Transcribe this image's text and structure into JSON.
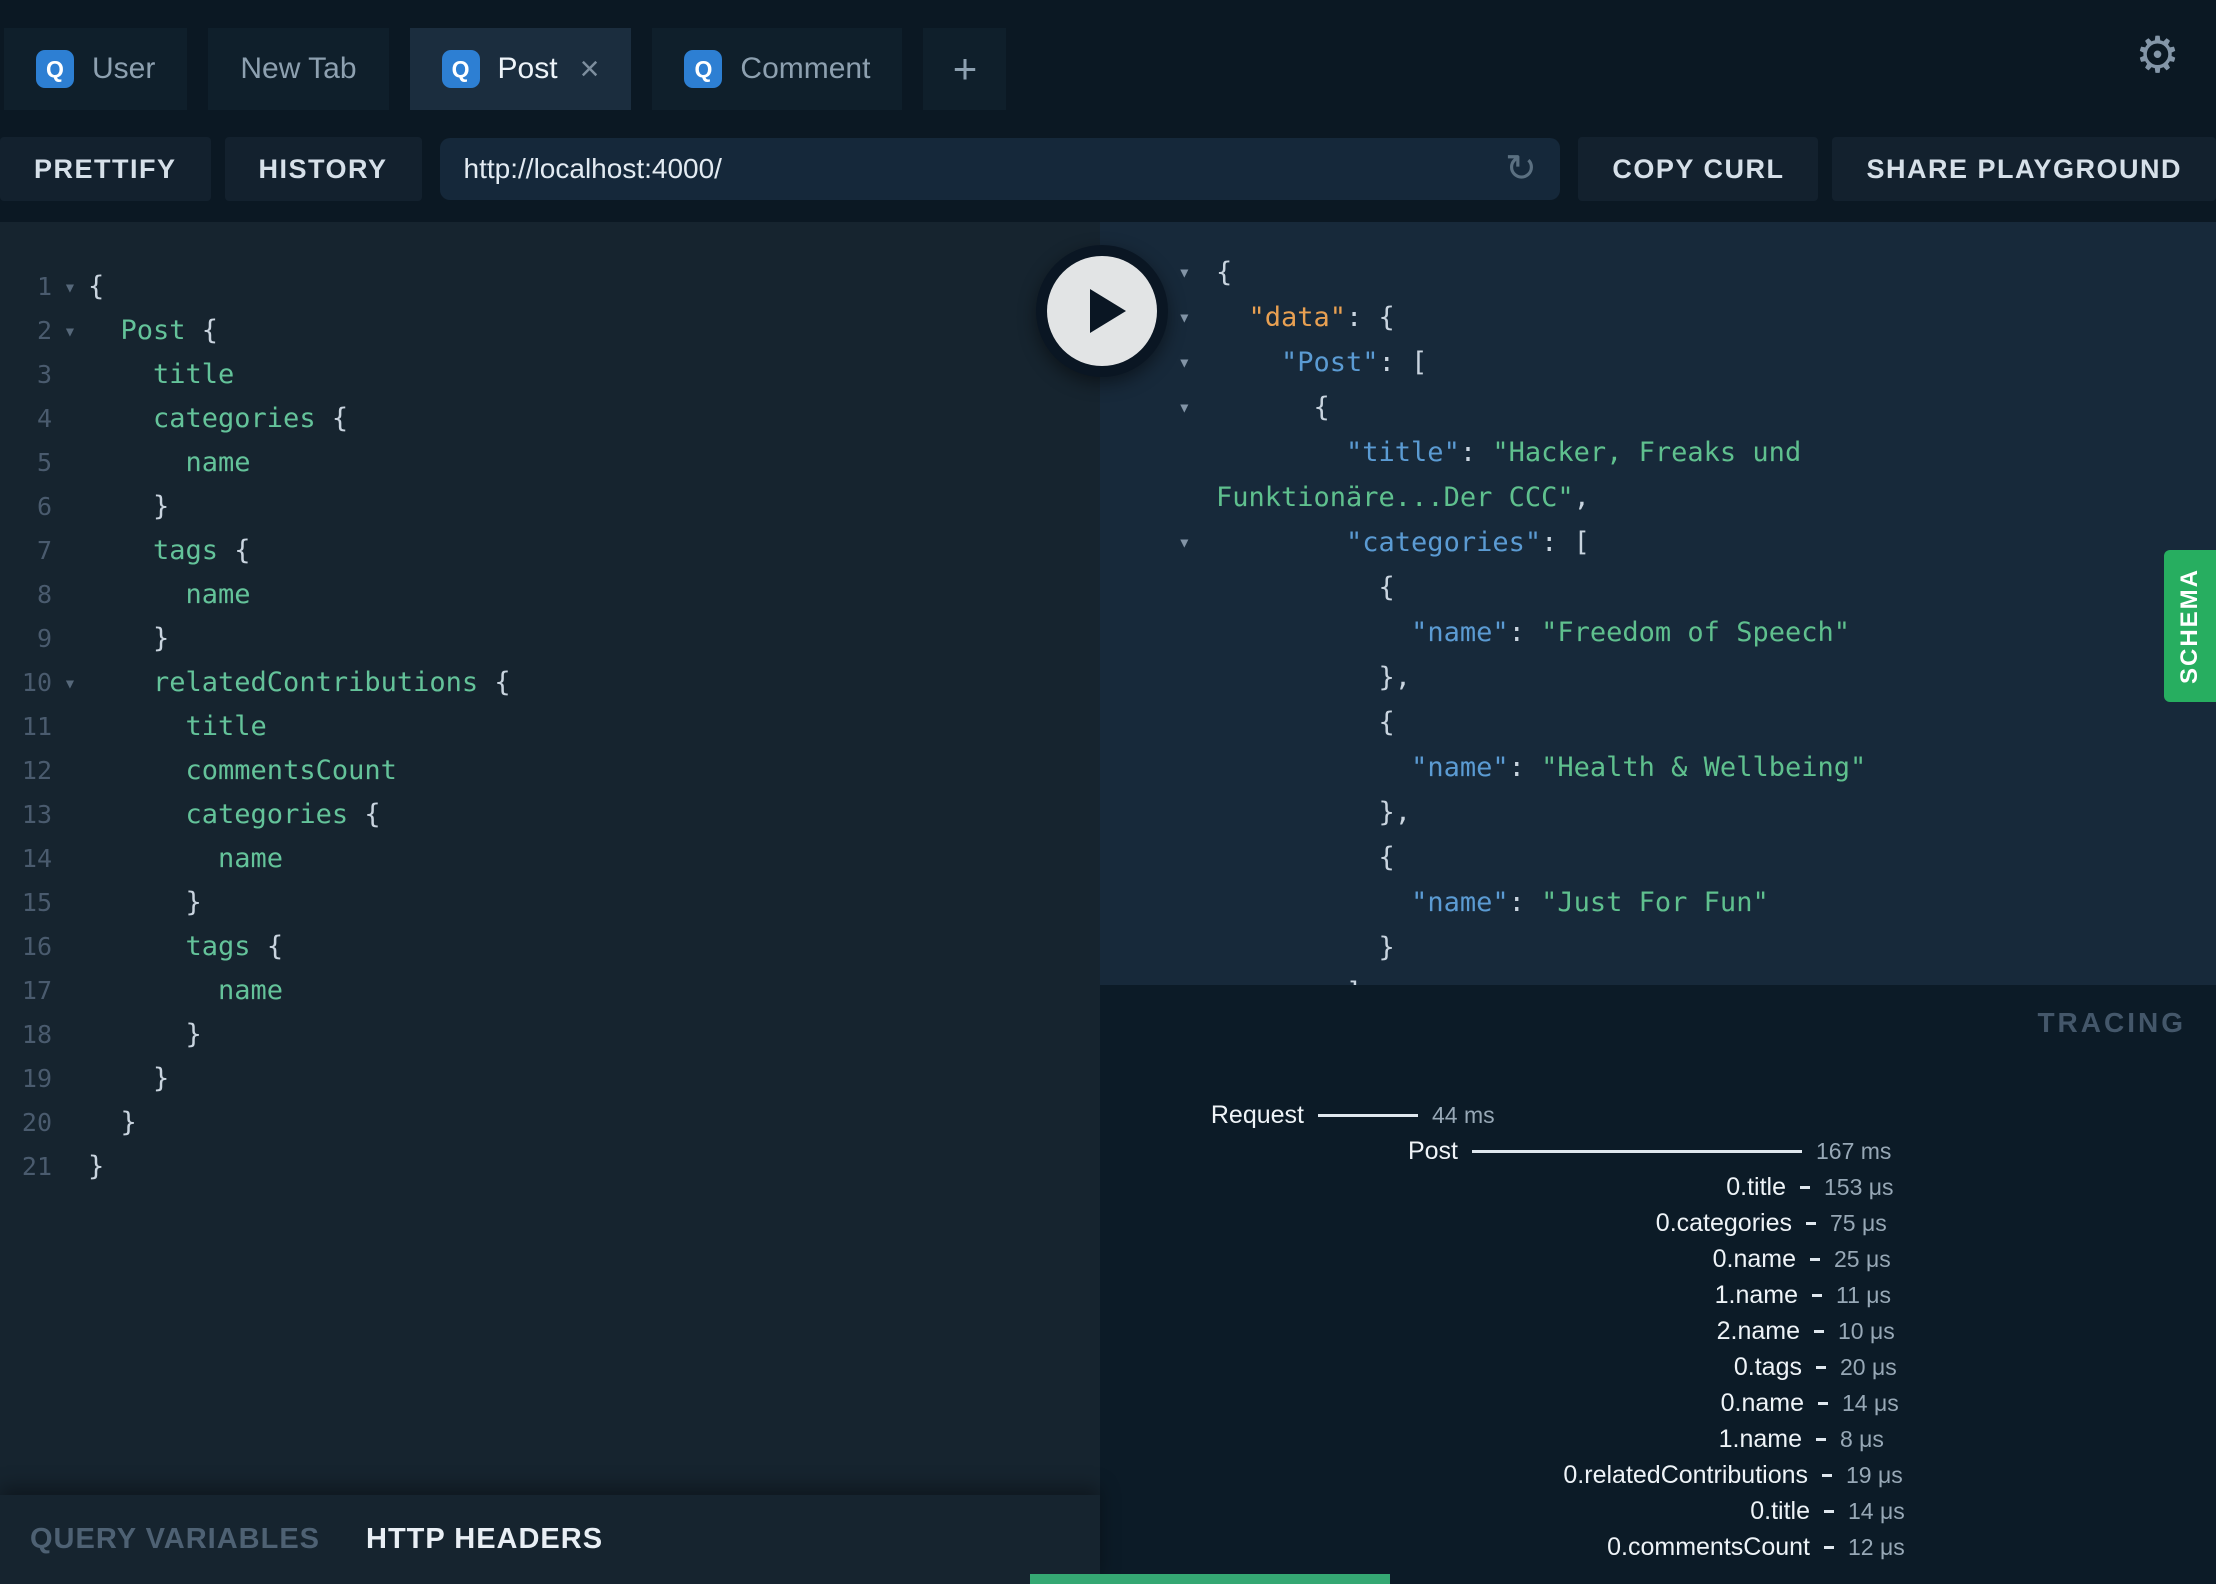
{
  "tabs": {
    "close_glyph": "×",
    "add_label": "+",
    "items": [
      {
        "label": "User",
        "badge": "Q",
        "active": false,
        "closable": false
      },
      {
        "label": "New Tab",
        "badge": null,
        "active": false,
        "closable": false
      },
      {
        "label": "Post",
        "badge": "Q",
        "active": true,
        "closable": true
      },
      {
        "label": "Comment",
        "badge": "Q",
        "active": false,
        "closable": false
      }
    ]
  },
  "icons": {
    "gear": "⚙",
    "reload": "↺",
    "fold": "▾"
  },
  "toolbar": {
    "prettify": "PRETTIFY",
    "history": "HISTORY",
    "url": "http://localhost:4000/",
    "copy_curl": "COPY CURL",
    "share": "SHARE PLAYGROUND"
  },
  "editor": {
    "lines": [
      {
        "n": 1,
        "i": 0,
        "fold": true,
        "tok": [
          [
            "p",
            "{"
          ]
        ]
      },
      {
        "n": 2,
        "i": 2,
        "fold": true,
        "tok": [
          [
            "f",
            "Post"
          ],
          [
            "p",
            " {"
          ]
        ]
      },
      {
        "n": 3,
        "i": 4,
        "fold": false,
        "tok": [
          [
            "f",
            "title"
          ]
        ]
      },
      {
        "n": 4,
        "i": 4,
        "fold": false,
        "tok": [
          [
            "f",
            "categories"
          ],
          [
            "p",
            " {"
          ]
        ]
      },
      {
        "n": 5,
        "i": 6,
        "fold": false,
        "tok": [
          [
            "f",
            "name"
          ]
        ]
      },
      {
        "n": 6,
        "i": 4,
        "fold": false,
        "tok": [
          [
            "p",
            "}"
          ]
        ]
      },
      {
        "n": 7,
        "i": 4,
        "fold": false,
        "tok": [
          [
            "f",
            "tags"
          ],
          [
            "p",
            " {"
          ]
        ]
      },
      {
        "n": 8,
        "i": 6,
        "fold": false,
        "tok": [
          [
            "f",
            "name"
          ]
        ]
      },
      {
        "n": 9,
        "i": 4,
        "fold": false,
        "tok": [
          [
            "p",
            "}"
          ]
        ]
      },
      {
        "n": 10,
        "i": 4,
        "fold": true,
        "tok": [
          [
            "f",
            "relatedContributions"
          ],
          [
            "p",
            " {"
          ]
        ]
      },
      {
        "n": 11,
        "i": 6,
        "fold": false,
        "tok": [
          [
            "f",
            "title"
          ]
        ]
      },
      {
        "n": 12,
        "i": 6,
        "fold": false,
        "tok": [
          [
            "f",
            "commentsCount"
          ]
        ]
      },
      {
        "n": 13,
        "i": 6,
        "fold": false,
        "tok": [
          [
            "f",
            "categories"
          ],
          [
            "p",
            " {"
          ]
        ]
      },
      {
        "n": 14,
        "i": 8,
        "fold": false,
        "tok": [
          [
            "f",
            "name"
          ]
        ]
      },
      {
        "n": 15,
        "i": 6,
        "fold": false,
        "tok": [
          [
            "p",
            "}"
          ]
        ]
      },
      {
        "n": 16,
        "i": 6,
        "fold": false,
        "tok": [
          [
            "f",
            "tags"
          ],
          [
            "p",
            " {"
          ]
        ]
      },
      {
        "n": 17,
        "i": 8,
        "fold": false,
        "tok": [
          [
            "f",
            "name"
          ]
        ]
      },
      {
        "n": 18,
        "i": 6,
        "fold": false,
        "tok": [
          [
            "p",
            "}"
          ]
        ]
      },
      {
        "n": 19,
        "i": 4,
        "fold": false,
        "tok": [
          [
            "p",
            "}"
          ]
        ]
      },
      {
        "n": 20,
        "i": 2,
        "fold": false,
        "tok": [
          [
            "p",
            "}"
          ]
        ]
      },
      {
        "n": 21,
        "i": 0,
        "fold": false,
        "tok": [
          [
            "p",
            "}"
          ]
        ]
      }
    ]
  },
  "response": {
    "lines": [
      {
        "i": 0,
        "arrow": true,
        "tok": [
          [
            "p",
            "{"
          ]
        ]
      },
      {
        "i": 2,
        "arrow": true,
        "tok": [
          [
            "ko",
            "\"data\""
          ],
          [
            "p",
            ": {"
          ]
        ]
      },
      {
        "i": 4,
        "arrow": true,
        "tok": [
          [
            "k",
            "\"Post\""
          ],
          [
            "p",
            ": ["
          ]
        ]
      },
      {
        "i": 6,
        "arrow": true,
        "tok": [
          [
            "p",
            "{"
          ]
        ]
      },
      {
        "i": 8,
        "arrow": false,
        "tok": [
          [
            "k",
            "\"title\""
          ],
          [
            "p",
            ": "
          ],
          [
            "s",
            "\"Hacker, Freaks und"
          ]
        ]
      },
      {
        "i": 0,
        "arrow": false,
        "tok": [
          [
            "s",
            "Funktionäre...Der CCC\""
          ],
          [
            "p",
            ","
          ]
        ]
      },
      {
        "i": 8,
        "arrow": true,
        "tok": [
          [
            "k",
            "\"categories\""
          ],
          [
            "p",
            ": ["
          ]
        ]
      },
      {
        "i": 10,
        "arrow": false,
        "tok": [
          [
            "p",
            "{"
          ]
        ]
      },
      {
        "i": 12,
        "arrow": false,
        "tok": [
          [
            "k",
            "\"name\""
          ],
          [
            "p",
            ": "
          ],
          [
            "s",
            "\"Freedom of Speech\""
          ]
        ]
      },
      {
        "i": 10,
        "arrow": false,
        "tok": [
          [
            "p",
            "},"
          ]
        ]
      },
      {
        "i": 10,
        "arrow": false,
        "tok": [
          [
            "p",
            "{"
          ]
        ]
      },
      {
        "i": 12,
        "arrow": false,
        "tok": [
          [
            "k",
            "\"name\""
          ],
          [
            "p",
            ": "
          ],
          [
            "s",
            "\"Health & Wellbeing\""
          ]
        ]
      },
      {
        "i": 10,
        "arrow": false,
        "tok": [
          [
            "p",
            "},"
          ]
        ]
      },
      {
        "i": 10,
        "arrow": false,
        "tok": [
          [
            "p",
            "{"
          ]
        ]
      },
      {
        "i": 12,
        "arrow": false,
        "tok": [
          [
            "k",
            "\"name\""
          ],
          [
            "p",
            ": "
          ],
          [
            "s",
            "\"Just For Fun\""
          ]
        ]
      },
      {
        "i": 10,
        "arrow": false,
        "tok": [
          [
            "p",
            "}"
          ]
        ]
      },
      {
        "i": 8,
        "arrow": false,
        "tok": [
          [
            "p",
            "]"
          ]
        ]
      }
    ]
  },
  "schema_tab": "SCHEMA",
  "tracing": {
    "title": "TRACING",
    "rows": [
      {
        "label": "Request",
        "time": "44 ms",
        "bar": 100,
        "pr": 664
      },
      {
        "label": "Post",
        "time": "167 ms",
        "bar": 330,
        "pr": 280
      },
      {
        "label": "0.title",
        "time": "153 μs",
        "bar": 10,
        "pr": 272
      },
      {
        "label": "0.categories",
        "time": "75 μs",
        "bar": 10,
        "pr": 266
      },
      {
        "label": "0.name",
        "time": "25 μs",
        "bar": 10,
        "pr": 262
      },
      {
        "label": "1.name",
        "time": "11 μs",
        "bar": 10,
        "pr": 260
      },
      {
        "label": "2.name",
        "time": "10 μs",
        "bar": 10,
        "pr": 258
      },
      {
        "label": "0.tags",
        "time": "20 μs",
        "bar": 10,
        "pr": 256
      },
      {
        "label": "0.name",
        "time": "14 μs",
        "bar": 10,
        "pr": 254
      },
      {
        "label": "1.name",
        "time": "8 μs",
        "bar": 10,
        "pr": 256
      },
      {
        "label": "0.relatedContributions",
        "time": "19 μs",
        "bar": 10,
        "pr": 250
      },
      {
        "label": "0.title",
        "time": "14 μs",
        "bar": 10,
        "pr": 248
      },
      {
        "label": "0.commentsCount",
        "time": "12 μs",
        "bar": 10,
        "pr": 248
      }
    ]
  },
  "footer": {
    "query_variables": "QUERY VARIABLES",
    "http_headers": "HTTP HEADERS"
  },
  "colors": {
    "accent_blue": "#2d7fd3",
    "schema_green": "#27ae60",
    "query_field_green": "#64c39a",
    "response_key_blue": "#5b9bd3",
    "response_data_orange": "#e8a052",
    "response_string_green": "#5fc08e",
    "partial_green_bar": "#35a873"
  }
}
